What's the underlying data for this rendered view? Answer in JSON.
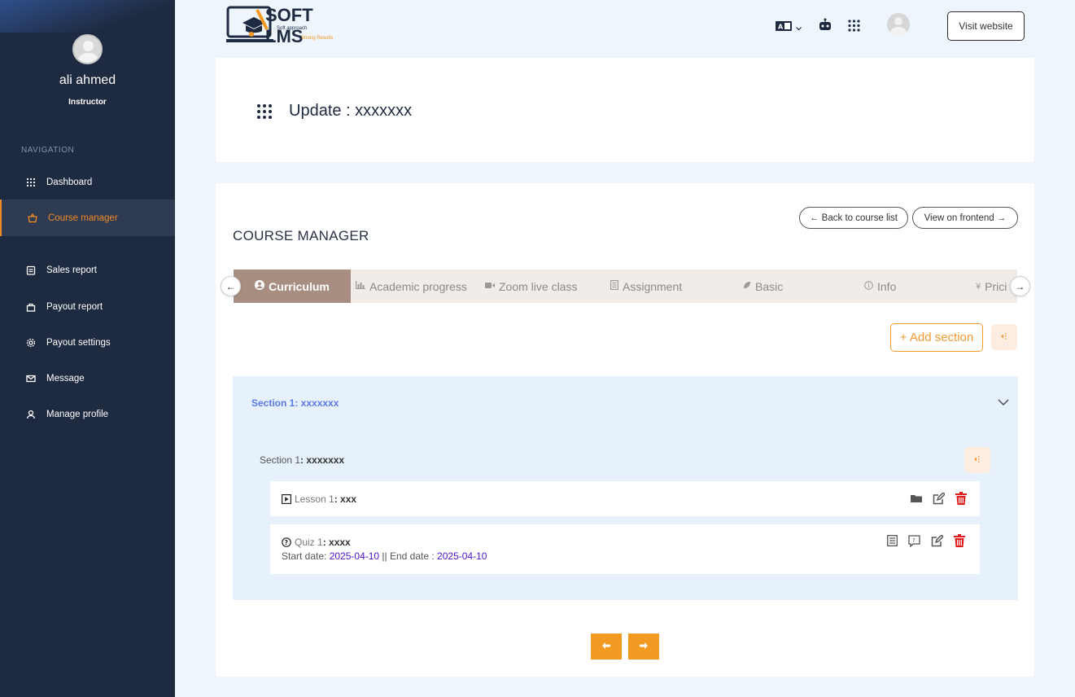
{
  "sidebar": {
    "user_name": "ali ahmed",
    "user_role": "Instructor",
    "nav_heading": "NAVIGATION",
    "items": [
      {
        "label": "Dashboard",
        "icon": "grid-icon"
      },
      {
        "label": "Course manager",
        "icon": "basket-icon"
      },
      {
        "label": "Sales report",
        "icon": "report-icon"
      },
      {
        "label": "Payout report",
        "icon": "bag-icon"
      },
      {
        "label": "Payout settings",
        "icon": "gear-icon"
      },
      {
        "label": "Message",
        "icon": "envelope-icon"
      },
      {
        "label": "Manage profile",
        "icon": "user-icon"
      }
    ],
    "active_color": "#f08a24"
  },
  "topbar": {
    "logo_text": "SOFT LMS",
    "logo_tagline_1": "Soft approach",
    "logo_tagline_2": "Strong Results",
    "language_icon": "language-icon",
    "robot_icon": "robot-icon",
    "apps_icon": "apps-grid-icon",
    "visit_website": "Visit website"
  },
  "header": {
    "title": "Update : xxxxxxx"
  },
  "course_manager": {
    "heading": "COURSE MANAGER",
    "back_button": "← Back to course list",
    "frontend_button": "View on frontend →",
    "tabs": [
      {
        "label": "Curriculum",
        "icon": "user-circle-icon",
        "active": true
      },
      {
        "label": "Academic progress",
        "icon": "bar-chart-icon"
      },
      {
        "label": "Zoom live class",
        "icon": "video-icon"
      },
      {
        "label": "Assignment",
        "icon": "document-icon"
      },
      {
        "label": "Basic",
        "icon": "leaf-icon"
      },
      {
        "label": "Info",
        "icon": "info-icon"
      },
      {
        "label": "Prici",
        "icon": "yen-icon"
      }
    ],
    "add_section": "+ Add section",
    "section": {
      "header": "Section 1: xxxxxxx",
      "inner_prefix": "Section 1",
      "inner_value": ": xxxxxxx",
      "lesson": {
        "prefix": "Lesson 1",
        "value": " : xxx"
      },
      "quiz": {
        "prefix": "Quiz 1",
        "value": " : xxxx",
        "start_label": "Start date: ",
        "start_date": "2025-04-10",
        "separator": " || End date : ",
        "end_date": "2025-04-10"
      }
    },
    "accent": "#f29a22",
    "delete_color": "#e31b1b"
  }
}
